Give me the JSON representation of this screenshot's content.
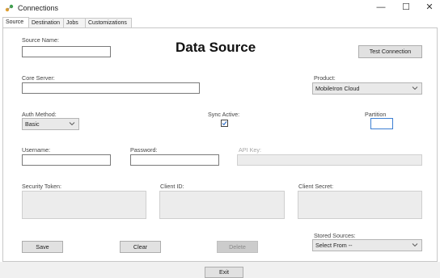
{
  "window": {
    "title": "Connections",
    "minimize_glyph": "—",
    "maximize_glyph": "☐",
    "close_glyph": "✕"
  },
  "tabs": [
    {
      "label": "Source",
      "active": true
    },
    {
      "label": "Destination",
      "active": false
    },
    {
      "label": "Jobs",
      "active": false
    },
    {
      "label": "Customizations",
      "active": false
    }
  ],
  "form": {
    "heading": "Data Source",
    "source_name": {
      "label": "Source Name:",
      "value": ""
    },
    "test_connection_label": "Test Connection",
    "core_server": {
      "label": "Core Server:",
      "value": ""
    },
    "product": {
      "label": "Product:",
      "value": "MobileIron Cloud"
    },
    "auth_method": {
      "label": "Auth Method:",
      "value": "Basic"
    },
    "sync_active": {
      "label": "Sync Active:",
      "checked": true
    },
    "partition": {
      "label": "Partition",
      "value": ""
    },
    "username": {
      "label": "Username:",
      "value": ""
    },
    "password": {
      "label": "Password:",
      "value": ""
    },
    "api_key": {
      "label": "API Key:",
      "value": ""
    },
    "security_token": {
      "label": "Security Token:",
      "value": ""
    },
    "client_id": {
      "label": "Client ID:",
      "value": ""
    },
    "client_secret": {
      "label": "Client Secret:",
      "value": ""
    },
    "stored_sources": {
      "label": "Stored Sources:",
      "value": "Select From --"
    },
    "save_label": "Save",
    "clear_label": "Clear",
    "delete_label": "Delete"
  },
  "footer": {
    "exit_label": "Exit"
  },
  "colors": {
    "accent": "#3c7fd3",
    "check": "#2f6fc7"
  }
}
